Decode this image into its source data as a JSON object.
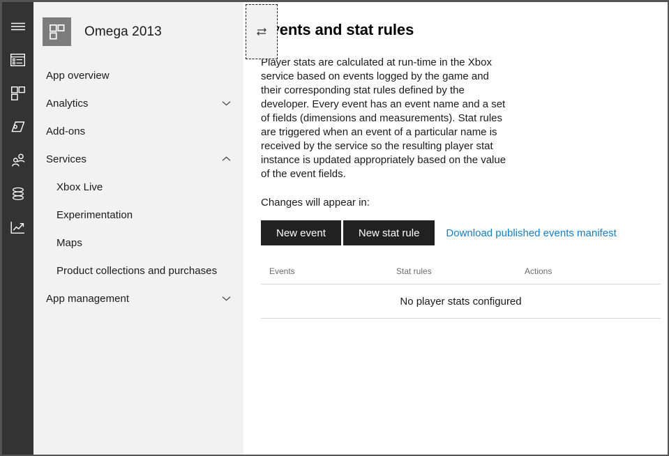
{
  "rail": {
    "items": [
      {
        "name": "hamburger-menu",
        "icon": "hamburger-icon"
      },
      {
        "name": "dashboard",
        "icon": "dashboard-icon"
      },
      {
        "name": "apps",
        "icon": "blocks-icon"
      },
      {
        "name": "tags",
        "icon": "tag-icon"
      },
      {
        "name": "people",
        "icon": "people-icon"
      },
      {
        "name": "data",
        "icon": "database-icon"
      },
      {
        "name": "analytics",
        "icon": "trending-chart-icon"
      }
    ]
  },
  "sidebar": {
    "app_title": "Omega 2013",
    "logo_icon": "app-blocks-logo-icon",
    "toggle_icon": "swap-arrows-icon",
    "items": [
      {
        "label": "App overview",
        "level": "top",
        "chevron": "none"
      },
      {
        "label": "Analytics",
        "level": "top",
        "chevron": "down"
      },
      {
        "label": "Add-ons",
        "level": "top",
        "chevron": "none"
      },
      {
        "label": "Services",
        "level": "top",
        "chevron": "up"
      },
      {
        "label": "Xbox Live",
        "level": "sub",
        "chevron": "none"
      },
      {
        "label": "Experimentation",
        "level": "sub",
        "chevron": "none"
      },
      {
        "label": "Maps",
        "level": "sub",
        "chevron": "none"
      },
      {
        "label": "Product collections and purchases",
        "level": "sub",
        "chevron": "none"
      },
      {
        "label": "App management",
        "level": "top",
        "chevron": "down"
      }
    ]
  },
  "main": {
    "title": "Events and stat rules",
    "intro": "Player stats are calculated at run-time in the Xbox service based on events logged by the game and their corresponding stat rules defined by the developer. Every event has an event name and a set of fields (dimensions and measurements). Stat rules are triggered when an event of a particular name is received by the service so the resulting player stat instance is updated appropriately based on the value of the event fields.",
    "changes_note": "Changes will appear in:",
    "new_event_label": "New event",
    "new_stat_rule_label": "New stat rule",
    "download_link_label": "Download published events manifest",
    "table": {
      "columns": [
        "Events",
        "Stat rules",
        "Actions"
      ],
      "rows": [],
      "empty_message": "No player stats configured"
    }
  },
  "colors": {
    "rail_bg": "#333333",
    "sidebar_bg": "#f2f2f2",
    "content_bg": "#ffffff",
    "button_bg": "#212121",
    "link": "#0f7fd4",
    "logo_tile": "#7c7c7c",
    "table_rule": "#d6d6d6",
    "window_border": "#555555"
  }
}
